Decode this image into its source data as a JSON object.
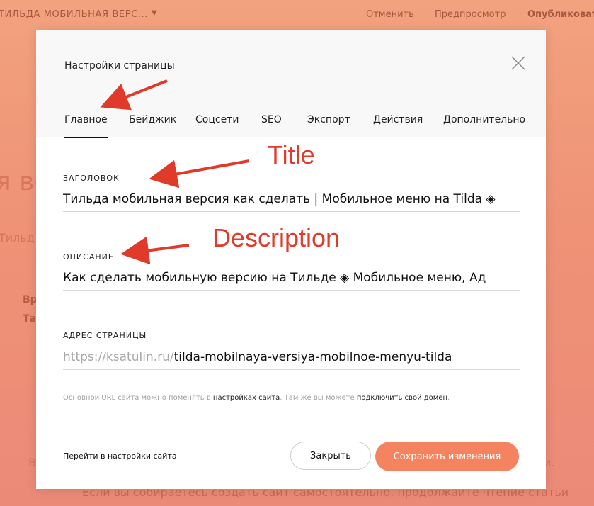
{
  "topbar": {
    "page_name": "ТИЛЬДА МОБИЛЬНАЯ ВЕРС...",
    "cancel": "Отменить",
    "preview": "Предпросмотр",
    "publish": "Опубликоват"
  },
  "background": {
    "heading": "я во",
    "subtitle": "Тильд",
    "bold_1": "Вр",
    "bold_2": "Та",
    "bottom_left": "В",
    "bottom_right": "и.",
    "bottom_line": "Если вы собираетесь создать сайт самостоятельно, продолжайте чтение статьи"
  },
  "modal": {
    "title": "Настройки страницы",
    "tabs": [
      {
        "label": "Главное",
        "active": true
      },
      {
        "label": "Бейджик"
      },
      {
        "label": "Соцсети"
      },
      {
        "label": "SEO"
      },
      {
        "label": "Экспорт"
      },
      {
        "label": "Действия"
      },
      {
        "label": "Дополнительно"
      }
    ],
    "fields": {
      "title_label": "ЗАГОЛОВОК",
      "title_value": "Тильда мобильная версия как сделать | Мобильное меню на Tilda ◈",
      "description_label": "ОПИСАНИЕ",
      "description_value": "Как сделать мобильную версию на Тильде ◈ Мобильное меню, Ад",
      "url_label": "АДРЕС СТРАНИЦЫ",
      "url_prefix": "https://ksatulin.ru/",
      "url_value": "tilda-mobilnaya-versiya-mobilnoe-menyu-tilda"
    },
    "hint": {
      "part1": "Основной URL сайта можно поменять в ",
      "link1": "настройках сайта",
      "part2": ". Там же вы можете ",
      "link2": "подключить свой домен",
      "part3": "."
    },
    "footer": {
      "site_settings": "Перейти в настройки сайта",
      "close": "Закрыть",
      "save": "Сохранить изменения"
    }
  },
  "annotations": {
    "title": "Title",
    "description": "Description",
    "color": "#e03a2b"
  },
  "colors": {
    "accent": "#f4845f",
    "background_overlay": "#ef9276"
  }
}
